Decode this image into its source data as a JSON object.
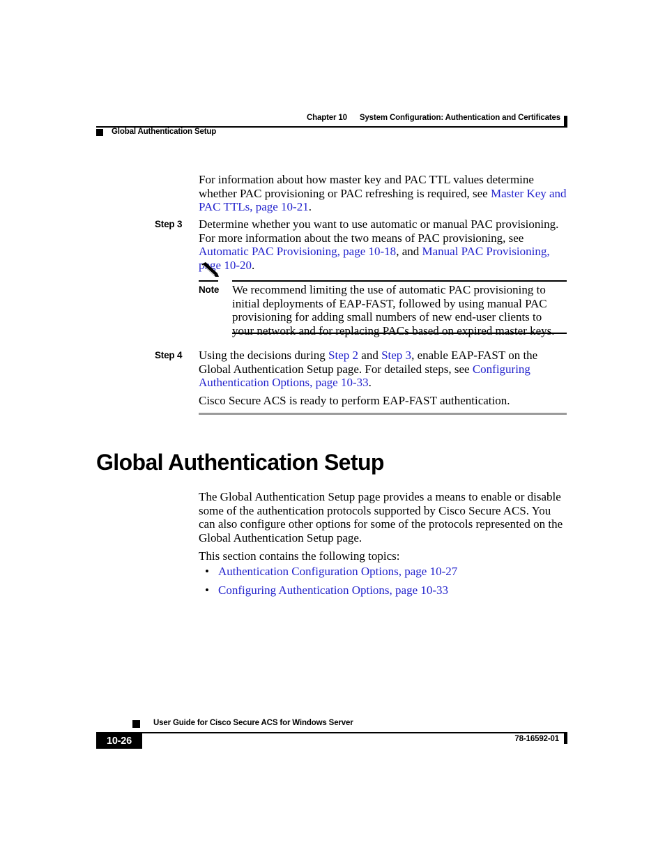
{
  "header": {
    "chapter_number": "Chapter 10",
    "chapter_title": "System Configuration: Authentication and Certificates",
    "section_title": "Global Authentication Setup"
  },
  "content": {
    "intro_paragraph": {
      "text_before": "For information about how master key and PAC TTL values determine whether PAC provisioning or PAC refreshing is required, see ",
      "link": "Master Key and PAC TTLs, page 10-21",
      "text_after": "."
    },
    "step3": {
      "label": "Step 3",
      "text_before": "Determine whether you want to use automatic or manual PAC provisioning. For more information about the two means of PAC provisioning, see ",
      "link1": "Automatic PAC Provisioning, page 10-18",
      "text_middle": ", and ",
      "link2": "Manual PAC Provisioning, page 10-20",
      "text_after": "."
    },
    "note": {
      "label": "Note",
      "icon": "pencil-icon",
      "text": "We recommend limiting the use of automatic PAC provisioning to initial deployments of EAP-FAST, followed by using manual PAC provisioning for adding small numbers of new end-user clients to your network and for replacing PACs based on expired master keys."
    },
    "step4": {
      "label": "Step 4",
      "text_before": "Using the decisions during ",
      "link1": "Step 2",
      "text_mid1": " and ",
      "link2": "Step 3",
      "text_mid2": ", enable EAP-FAST on the Global Authentication Setup page. For detailed steps, see ",
      "link3": "Configuring Authentication Options, page 10-33",
      "text_after": "."
    },
    "closing_paragraph": "Cisco Secure ACS is ready to perform EAP-FAST authentication."
  },
  "section": {
    "heading": "Global Authentication Setup",
    "paragraph1": "The Global Authentication Setup page provides a means to enable or disable some of the authentication protocols supported by Cisco Secure ACS. You can also configure other options for some of the protocols represented on the Global Authentication Setup page.",
    "paragraph2": "This section contains the following topics:",
    "topics": [
      {
        "bullet": "•",
        "label": "Authentication Configuration Options, page 10-27"
      },
      {
        "bullet": "•",
        "label": "Configuring Authentication Options, page 10-33"
      }
    ]
  },
  "footer": {
    "guide_title": "User Guide for Cisco Secure ACS for Windows Server",
    "page_number": "10-26",
    "document_number": "78-16592-01"
  },
  "colors": {
    "link": "#2222cc",
    "rule_gray": "#9a9a9a",
    "text": "#000000",
    "background": "#ffffff"
  }
}
